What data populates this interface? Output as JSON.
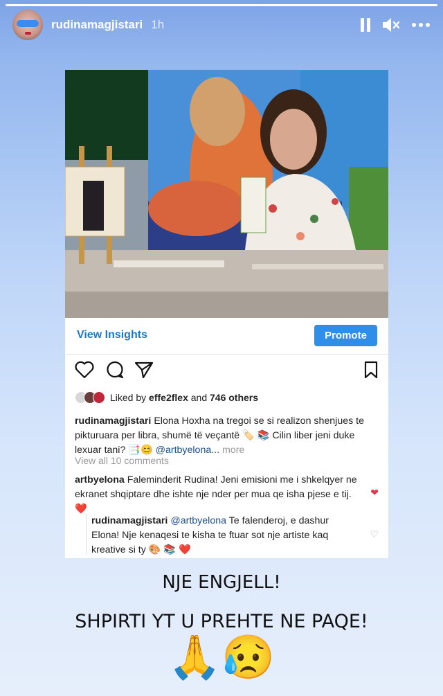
{
  "story": {
    "progress": 1.0
  },
  "header": {
    "username": "rudinamagjistari",
    "time": "1h",
    "controls": {
      "pause_icon": "pause-icon",
      "mute_icon": "mute-icon",
      "more_icon": "more-icon"
    }
  },
  "post": {
    "photo_alt_icon": "tv-studio-photo",
    "view_insights": "View Insights",
    "promote": "Promote",
    "likes": {
      "prefix": "Liked by ",
      "user": "effe2flex",
      "middle": " and ",
      "count": "746 others"
    },
    "caption": {
      "user": "rudinamagjistari",
      "text": " Elona Hoxha na tregoi se si realizon shenjues te pikturuara per libra, shumë të veçantë 🏷️ 📚 Cilin liber jeni duke lexuar tani? 📑😊 ",
      "mention": "@artbyelona...",
      "more": " more"
    },
    "view_all_comments": "View all 10 comments",
    "comment1": {
      "user": "artbyelona",
      "text": " Faleminderit Rudina! Jeni emisioni me i shkelqyer ne ekranet shqiptare dhe ishte nje nder per mua qe isha pjese e tij. ❤️"
    },
    "reply": {
      "user": "rudinamagjistari",
      "mention": " @artbyelona",
      "text": " Te falenderoj, e dashur Elona! Nje kenaqesi te kisha te ftuar sot nje artiste kaq kreative si ty 🎨 📚 ❤️"
    }
  },
  "overlay": {
    "line1": "NJE ENGJELL!",
    "line2": "SHPIRTI YT U PREHTE NE PAQE!",
    "emojis": "🙏😥"
  }
}
